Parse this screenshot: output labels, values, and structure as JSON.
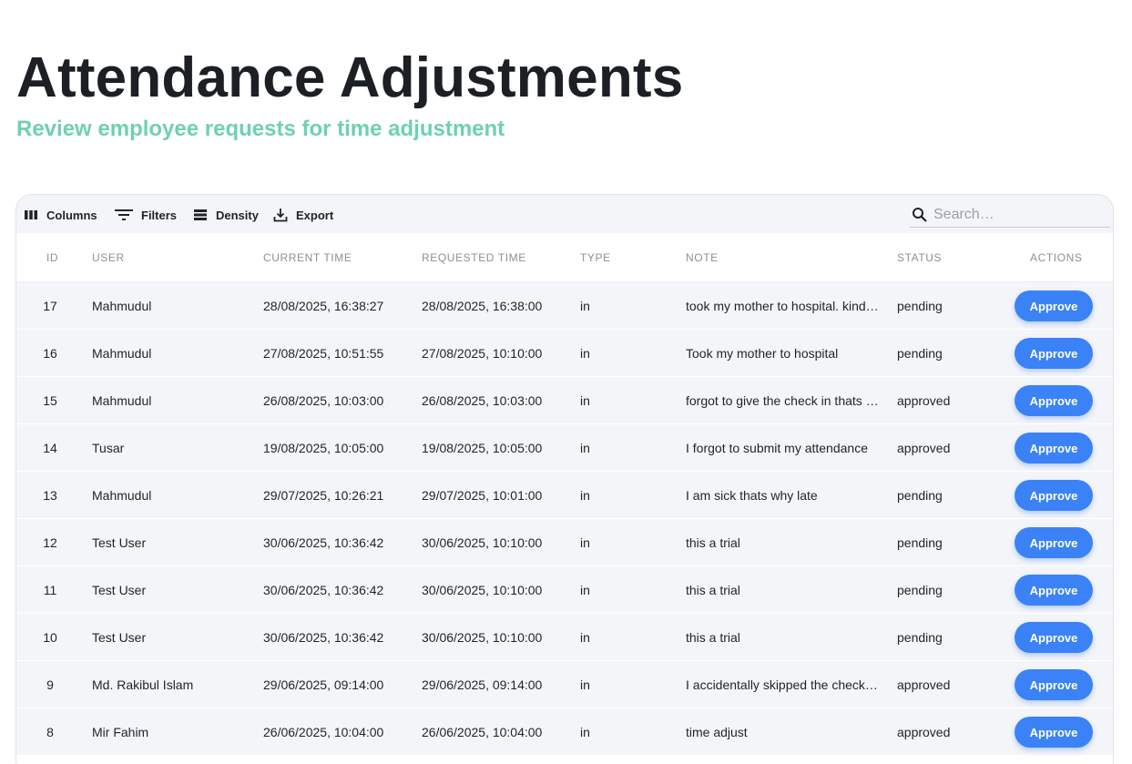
{
  "header": {
    "title": "Attendance Adjustments",
    "subtitle": "Review employee requests for time adjustment"
  },
  "toolbar": {
    "columns_label": "Columns",
    "filters_label": "Filters",
    "density_label": "Density",
    "export_label": "Export",
    "search_placeholder": "Search…"
  },
  "table": {
    "headers": {
      "id": "ID",
      "user": "USER",
      "current_time": "CURRENT TIME",
      "requested_time": "REQUESTED TIME",
      "type": "TYPE",
      "note": "NOTE",
      "status": "STATUS",
      "actions": "ACTIONS"
    },
    "action_label": "Approve",
    "rows": [
      {
        "id": "17",
        "user": "Mahmudul",
        "current_time": "28/08/2025, 16:38:27",
        "requested_time": "28/08/2025, 16:38:00",
        "type": "in",
        "note": "took my mother to hospital. kind…",
        "status": "pending"
      },
      {
        "id": "16",
        "user": "Mahmudul",
        "current_time": "27/08/2025, 10:51:55",
        "requested_time": "27/08/2025, 10:10:00",
        "type": "in",
        "note": "Took my mother to hospital",
        "status": "pending"
      },
      {
        "id": "15",
        "user": "Mahmudul",
        "current_time": "26/08/2025, 10:03:00",
        "requested_time": "26/08/2025, 10:03:00",
        "type": "in",
        "note": "forgot to give the check in thats …",
        "status": "approved"
      },
      {
        "id": "14",
        "user": "Tusar",
        "current_time": "19/08/2025, 10:05:00",
        "requested_time": "19/08/2025, 10:05:00",
        "type": "in",
        "note": "I forgot to submit my attendance",
        "status": "approved"
      },
      {
        "id": "13",
        "user": "Mahmudul",
        "current_time": "29/07/2025, 10:26:21",
        "requested_time": "29/07/2025, 10:01:00",
        "type": "in",
        "note": "I am sick thats why late",
        "status": "pending"
      },
      {
        "id": "12",
        "user": "Test User",
        "current_time": "30/06/2025, 10:36:42",
        "requested_time": "30/06/2025, 10:10:00",
        "type": "in",
        "note": "this a trial",
        "status": "pending"
      },
      {
        "id": "11",
        "user": "Test User",
        "current_time": "30/06/2025, 10:36:42",
        "requested_time": "30/06/2025, 10:10:00",
        "type": "in",
        "note": "this a trial",
        "status": "pending"
      },
      {
        "id": "10",
        "user": "Test User",
        "current_time": "30/06/2025, 10:36:42",
        "requested_time": "30/06/2025, 10:10:00",
        "type": "in",
        "note": "this a trial",
        "status": "pending"
      },
      {
        "id": "9",
        "user": "Md. Rakibul Islam",
        "current_time": "29/06/2025, 09:14:00",
        "requested_time": "29/06/2025, 09:14:00",
        "type": "in",
        "note": "I accidentally skipped the check…",
        "status": "approved"
      },
      {
        "id": "8",
        "user": "Mir Fahim",
        "current_time": "26/06/2025, 10:04:00",
        "requested_time": "26/06/2025, 10:04:00",
        "type": "in",
        "note": "time adjust",
        "status": "approved"
      }
    ]
  },
  "icons": {
    "columns": "columns-icon",
    "filters": "filter-icon",
    "density": "density-icon",
    "export": "export-icon",
    "search": "search-icon"
  },
  "colors": {
    "subtitle": "#6fd0b4",
    "approve_button": "#3b82f6"
  }
}
